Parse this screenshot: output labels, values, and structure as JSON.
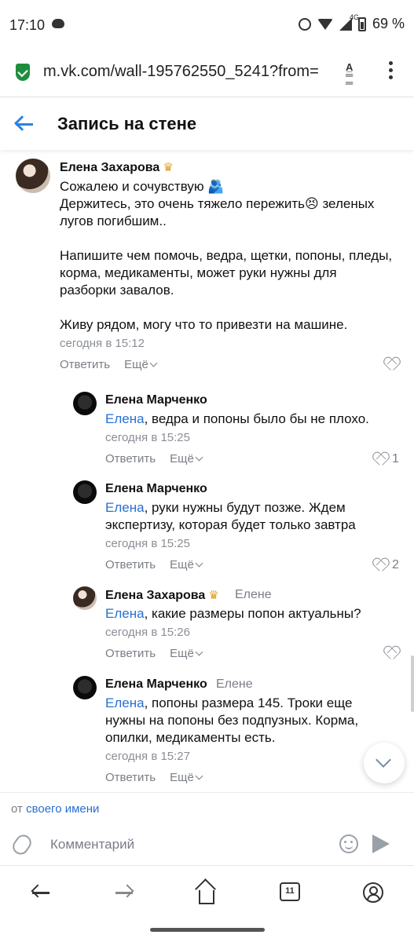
{
  "status_bar": {
    "time": "17:10",
    "network": "4G",
    "battery": "69 %"
  },
  "browser": {
    "url": "m.vk.com/wall-195762550_5241?from="
  },
  "header": {
    "title": "Запись на стене"
  },
  "comments": [
    {
      "author": "Елена Захарова",
      "has_crown": true,
      "reply_to": "",
      "mention": "",
      "lines": [
        "Сожалею и сочувствую 🫂",
        "Держитесь, это очень тяжело пережить😣 зеленых",
        "лугов погибшим..",
        "",
        "Напишите чем помочь, ведра, щетки, попоны, пледы,",
        "корма, медикаменты, может руки нужны для",
        "разборки завалов.",
        "",
        "Живу рядом, могу что то привезти на машине."
      ],
      "time": "сегодня в 15:12",
      "reply_label": "Ответить",
      "more_label": "Ещё",
      "likes": ""
    },
    {
      "author": "Елена Марченко",
      "has_crown": false,
      "reply_to": "",
      "mention": "Елена",
      "lines": [
        ", ведра и попоны было бы не плохо."
      ],
      "time": "сегодня в 15:25",
      "reply_label": "Ответить",
      "more_label": "Ещё",
      "likes": "1"
    },
    {
      "author": "Елена Марченко",
      "has_crown": false,
      "reply_to": "",
      "mention": "Елена",
      "lines": [
        ", руки нужны будут позже. Ждем",
        "экспертизу, которая будет только завтра"
      ],
      "time": "сегодня в 15:25",
      "reply_label": "Ответить",
      "more_label": "Ещё",
      "likes": "2"
    },
    {
      "author": "Елена Захарова",
      "has_crown": true,
      "reply_to": "Елене",
      "mention": "Елена",
      "lines": [
        ", какие размеры попон актуальны?"
      ],
      "time": "сегодня в 15:26",
      "reply_label": "Ответить",
      "more_label": "Ещё",
      "likes": ""
    },
    {
      "author": "Елена Марченко",
      "has_crown": false,
      "reply_to": "Елене",
      "mention": "Елена",
      "lines": [
        ", попоны размера 145. Троки еще",
        "нужны на попоны без подпузных. Корма,",
        "опилки, медикаменты есть."
      ],
      "time": "сегодня в 15:27",
      "reply_label": "Ответить",
      "more_label": "Ещё",
      "likes": ""
    }
  ],
  "composer": {
    "from_prefix": "от",
    "from_link": "своего имени",
    "placeholder": "Комментарий"
  },
  "browser_nav": {
    "tabs_count": "11"
  },
  "colors": {
    "accent": "#2a83e6",
    "link": "#2a6fd1",
    "muted": "#7a7e85",
    "secure": "#1e8e3e"
  }
}
